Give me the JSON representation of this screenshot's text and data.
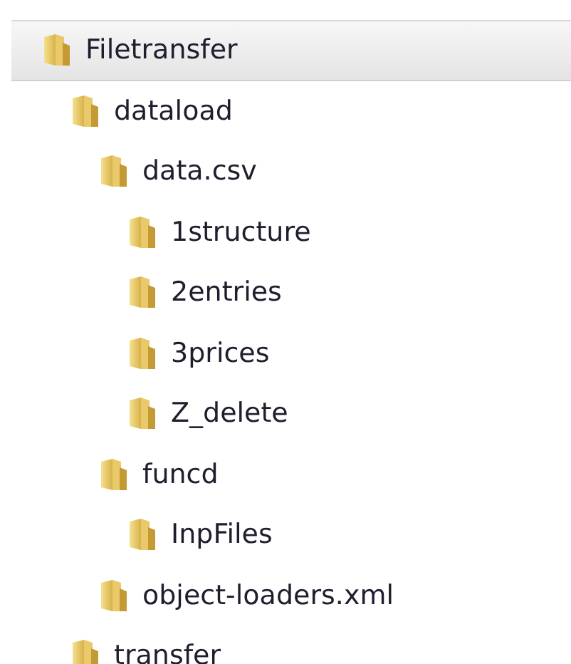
{
  "tree": [
    {
      "label": "Filetransfer",
      "selected": true,
      "children": [
        {
          "label": "dataload",
          "selected": false,
          "children": [
            {
              "label": "data.csv",
              "selected": false,
              "children": [
                {
                  "label": "1structure",
                  "selected": false
                },
                {
                  "label": "2entries",
                  "selected": false
                },
                {
                  "label": "3prices",
                  "selected": false
                },
                {
                  "label": "Z_delete",
                  "selected": false
                }
              ]
            },
            {
              "label": "funcd",
              "selected": false,
              "children": [
                {
                  "label": "InpFiles",
                  "selected": false
                }
              ]
            },
            {
              "label": "object-loaders.xml",
              "selected": false
            }
          ]
        },
        {
          "label": "transfer",
          "selected": false
        }
      ]
    }
  ]
}
